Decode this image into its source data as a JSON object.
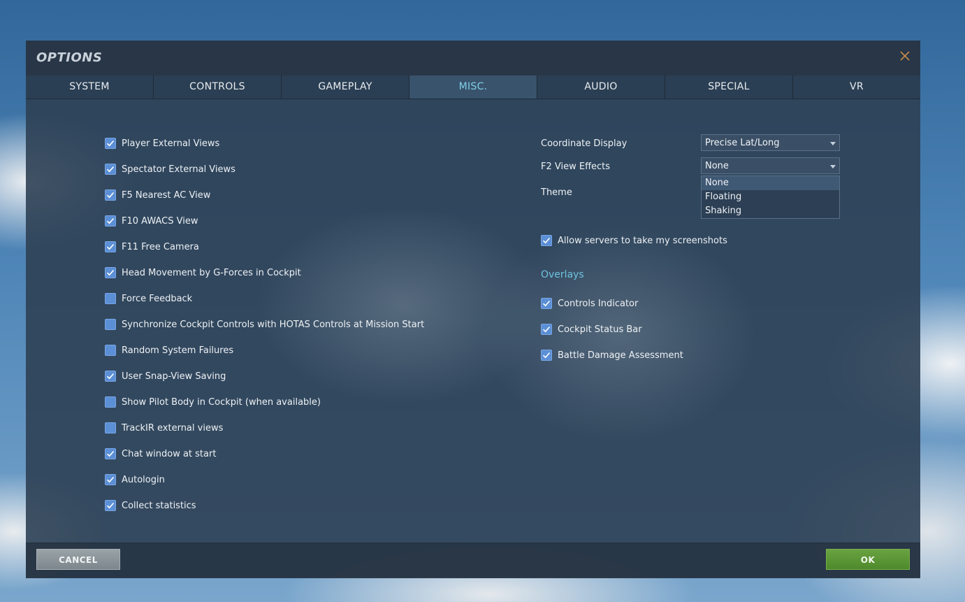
{
  "window": {
    "title": "OPTIONS"
  },
  "tabs": [
    "SYSTEM",
    "CONTROLS",
    "GAMEPLAY",
    "MISC.",
    "AUDIO",
    "SPECIAL",
    "VR"
  ],
  "active_tab": "MISC.",
  "left_options": [
    {
      "label": "Player External Views",
      "checked": true
    },
    {
      "label": "Spectator External Views",
      "checked": true
    },
    {
      "label": "F5 Nearest AC View",
      "checked": true
    },
    {
      "label": "F10 AWACS View",
      "checked": true
    },
    {
      "label": "F11 Free Camera",
      "checked": true
    },
    {
      "label": "Head Movement by G-Forces in Cockpit",
      "checked": true
    },
    {
      "label": "Force Feedback",
      "checked": false
    },
    {
      "label": "Synchronize Cockpit Controls with HOTAS Controls at Mission Start",
      "checked": false
    },
    {
      "label": "Random System Failures",
      "checked": false
    },
    {
      "label": "User Snap-View Saving",
      "checked": true
    },
    {
      "label": "Show Pilot Body in Cockpit (when available)",
      "checked": false
    },
    {
      "label": "TrackIR external views",
      "checked": false
    },
    {
      "label": "Chat window at start",
      "checked": true
    },
    {
      "label": "Autologin",
      "checked": true
    },
    {
      "label": "Collect statistics",
      "checked": true
    }
  ],
  "right": {
    "coordinate_display": {
      "label": "Coordinate Display",
      "value": "Precise Lat/Long"
    },
    "f2_view_effects": {
      "label": "F2 View Effects",
      "value": "None",
      "options": [
        "None",
        "Floating",
        "Shaking"
      ]
    },
    "theme": {
      "label": "Theme"
    },
    "allow_screenshots": {
      "label": "Allow servers to take my screenshots",
      "checked": true
    },
    "overlays": {
      "title": "Overlays",
      "items": [
        {
          "label": "Controls Indicator",
          "checked": true
        },
        {
          "label": "Cockpit Status Bar",
          "checked": true
        },
        {
          "label": "Battle Damage Assessment",
          "checked": true
        }
      ]
    }
  },
  "footer": {
    "cancel_label": "CANCEL",
    "ok_label": "OK"
  },
  "colors": {
    "accent": "#7fcfe6",
    "checkbox": "#5b8fd6",
    "ok_green": "#5a9636"
  }
}
